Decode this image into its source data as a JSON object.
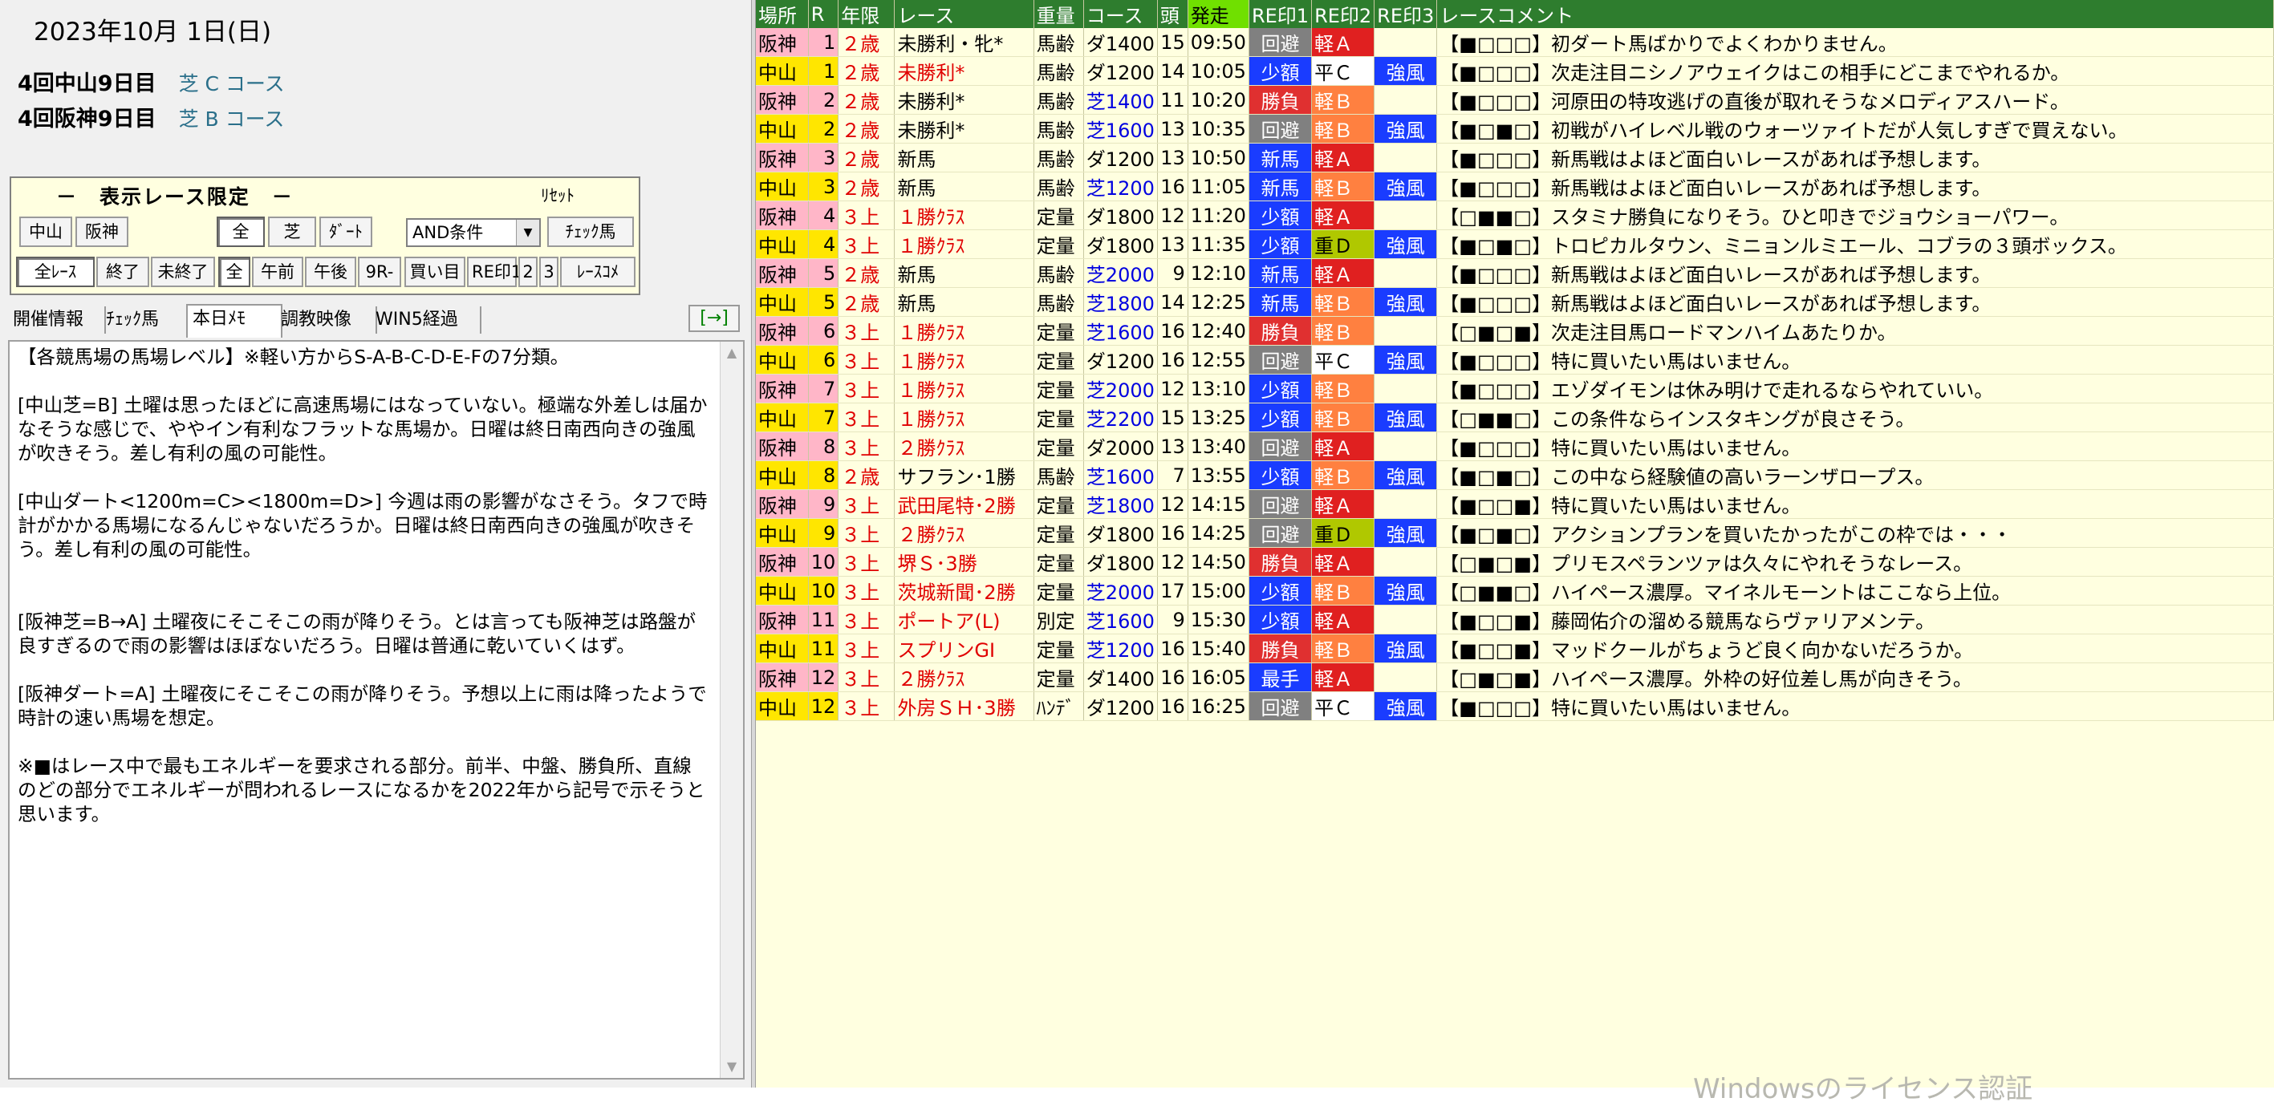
{
  "left": {
    "date": "2023年10月 1日(日)",
    "meetings": [
      {
        "name": "4回中山9日目",
        "course": "芝 C コース"
      },
      {
        "name": "4回阪神9日目",
        "course": "芝 B コース"
      }
    ],
    "filter": {
      "title": "－　表示レース限定　－",
      "reset": "ﾘｾｯﾄ",
      "buttons_row1": [
        "中山",
        "阪神",
        "全",
        "芝",
        "ﾀﾞｰﾄ",
        "ﾁｪｯｸ馬"
      ],
      "select_value": "AND条件",
      "buttons_row2": [
        "全ﾚｰｽ",
        "終了",
        "未終了",
        "全",
        "午前",
        "午後",
        "9R-",
        "買い目",
        "RE印1",
        "2",
        "3",
        "ﾚｰｽｺﾒ"
      ]
    },
    "tabs": [
      "開催情報",
      "ﾁｪｯｸ馬",
      "本日ﾒﾓ",
      "調教映像",
      "WIN5経過"
    ],
    "arrow_button": "[→]",
    "memo": "【各競馬場の馬場レベル】※軽い方からS-A-B-C-D-E-Fの7分類。\n\n[中山芝=B] 土曜は思ったほどに高速馬場にはなっていない。極端な外差しは届かなそうな感じで、ややイン有利なフラットな馬場か。日曜は終日南西向きの強風が吹きそう。差し有利の風の可能性。\n\n[中山ダート<1200m=C><1800m=D>] 今週は雨の影響がなさそう。タフで時計がかかる馬場になるんじゃないだろうか。日曜は終日南西向きの強風が吹きそう。差し有利の風の可能性。\n\n\n[阪神芝=B→A] 土曜夜にそこそこの雨が降りそう。とは言っても阪神芝は路盤が良すぎるので雨の影響はほぼないだろう。日曜は普通に乾いていくはず。\n\n[阪神ダート=A] 土曜夜にそこそこの雨が降りそう。予想以上に雨は降ったようで時計の速い馬場を想定。\n\n※■はレース中で最もエネルギーを要求される部分。前半、中盤、勝負所、直線のどの部分でエネルギーが問われるレースになるかを2022年から記号で示そうと思います。"
  },
  "table": {
    "headers": [
      "場所",
      "R",
      "年限",
      "レース",
      "重量",
      "コース",
      "頭",
      "発走",
      "RE印1",
      "RE印2",
      "RE印3",
      "レースコメント"
    ],
    "rows": [
      {
        "place": "阪神",
        "r": "1",
        "age": "２歳",
        "race": "未勝利・牝*",
        "race_red": false,
        "weight": "馬齢",
        "course": "ダ1400",
        "course_turf": false,
        "heads": "15",
        "time": "09:50",
        "m1": "回避",
        "m1c": "kaihi",
        "m2": "軽Ａ",
        "m2c": "keiA",
        "m3": "",
        "comment": "【■□□□】初ダート馬ばかりでよくわかりません。"
      },
      {
        "place": "中山",
        "r": "1",
        "age": "２歳",
        "race": "未勝利*",
        "race_red": true,
        "weight": "馬齢",
        "course": "ダ1200",
        "course_turf": false,
        "heads": "14",
        "time": "10:05",
        "m1": "少額",
        "m1c": "shogaku",
        "m2": "平Ｃ",
        "m2c": "heiC",
        "m3": "強風",
        "comment": "【■□□□】次走注目ニシノアウェイクはこの相手にどこまでやれるか。"
      },
      {
        "place": "阪神",
        "r": "2",
        "age": "２歳",
        "race": "未勝利*",
        "race_red": false,
        "weight": "馬齢",
        "course": "芝1400",
        "course_turf": true,
        "heads": "11",
        "time": "10:20",
        "m1": "勝負",
        "m1c": "shoubu",
        "m2": "軽Ｂ",
        "m2c": "keiB",
        "m3": "",
        "comment": "【■□□□】河原田の特攻逃げの直後が取れそうなメロディアスハード。"
      },
      {
        "place": "中山",
        "r": "2",
        "age": "２歳",
        "race": "未勝利*",
        "race_red": false,
        "weight": "馬齢",
        "course": "芝1600",
        "course_turf": true,
        "heads": "13",
        "time": "10:35",
        "m1": "回避",
        "m1c": "kaihi",
        "m2": "軽Ｂ",
        "m2c": "keiB",
        "m3": "強風",
        "comment": "【■□■□】初戦がハイレベル戦のウォーツァイトだが人気しすぎで買えない。"
      },
      {
        "place": "阪神",
        "r": "3",
        "age": "２歳",
        "race": "新馬",
        "race_red": false,
        "weight": "馬齢",
        "course": "ダ1200",
        "course_turf": false,
        "heads": "13",
        "time": "10:50",
        "m1": "新馬",
        "m1c": "shinba",
        "m2": "軽Ａ",
        "m2c": "keiA",
        "m3": "",
        "comment": "【■□□□】新馬戦はよほど面白いレースがあれば予想します。"
      },
      {
        "place": "中山",
        "r": "3",
        "age": "２歳",
        "race": "新馬",
        "race_red": false,
        "weight": "馬齢",
        "course": "芝1200",
        "course_turf": true,
        "heads": "16",
        "time": "11:05",
        "m1": "新馬",
        "m1c": "shinba",
        "m2": "軽Ｂ",
        "m2c": "keiB",
        "m3": "強風",
        "comment": "【■□□□】新馬戦はよほど面白いレースがあれば予想します。"
      },
      {
        "place": "阪神",
        "r": "4",
        "age": "３上",
        "race": "１勝ｸﾗｽ",
        "race_red": true,
        "weight": "定量",
        "course": "ダ1800",
        "course_turf": false,
        "heads": "12",
        "time": "11:20",
        "m1": "少額",
        "m1c": "shogaku",
        "m2": "軽Ａ",
        "m2c": "keiA",
        "m3": "",
        "comment": "【□■■□】スタミナ勝負になりそう。ひと叩きでジョウショーパワー。"
      },
      {
        "place": "中山",
        "r": "4",
        "age": "３上",
        "race": "１勝ｸﾗｽ",
        "race_red": true,
        "weight": "定量",
        "course": "ダ1800",
        "course_turf": false,
        "heads": "13",
        "time": "11:35",
        "m1": "少額",
        "m1c": "shogaku",
        "m2": "重Ｄ",
        "m2c": "juuD",
        "m3": "強風",
        "comment": "【■□■□】トロピカルタウン、ミニョンルミエール、コブラの３頭ボックス。"
      },
      {
        "place": "阪神",
        "r": "5",
        "age": "２歳",
        "race": "新馬",
        "race_red": false,
        "weight": "馬齢",
        "course": "芝2000",
        "course_turf": true,
        "heads": "9",
        "time": "12:10",
        "m1": "新馬",
        "m1c": "shinba",
        "m2": "軽Ａ",
        "m2c": "keiA",
        "m3": "",
        "comment": "【■□□□】新馬戦はよほど面白いレースがあれば予想します。"
      },
      {
        "place": "中山",
        "r": "5",
        "age": "２歳",
        "race": "新馬",
        "race_red": false,
        "weight": "馬齢",
        "course": "芝1800",
        "course_turf": true,
        "heads": "14",
        "time": "12:25",
        "m1": "新馬",
        "m1c": "shinba",
        "m2": "軽Ｂ",
        "m2c": "keiB",
        "m3": "強風",
        "comment": "【■□□□】新馬戦はよほど面白いレースがあれば予想します。"
      },
      {
        "place": "阪神",
        "r": "6",
        "age": "３上",
        "race": "１勝ｸﾗｽ",
        "race_red": true,
        "weight": "定量",
        "course": "芝1600",
        "course_turf": true,
        "heads": "16",
        "time": "12:40",
        "m1": "勝負",
        "m1c": "shoubu",
        "m2": "軽Ｂ",
        "m2c": "keiB",
        "m3": "",
        "comment": "【□■□■】次走注目馬ロードマンハイムあたりか。"
      },
      {
        "place": "中山",
        "r": "6",
        "age": "３上",
        "race": "１勝ｸﾗｽ",
        "race_red": true,
        "weight": "定量",
        "course": "ダ1200",
        "course_turf": false,
        "heads": "16",
        "time": "12:55",
        "m1": "回避",
        "m1c": "kaihi",
        "m2": "平Ｃ",
        "m2c": "heiC",
        "m3": "強風",
        "comment": "【■□□□】特に買いたい馬はいません。"
      },
      {
        "place": "阪神",
        "r": "7",
        "age": "３上",
        "race": "１勝ｸﾗｽ",
        "race_red": true,
        "weight": "定量",
        "course": "芝2000",
        "course_turf": true,
        "heads": "12",
        "time": "13:10",
        "m1": "少額",
        "m1c": "shogaku",
        "m2": "軽Ｂ",
        "m2c": "keiB",
        "m3": "",
        "comment": "【■□□□】エゾダイモンは休み明けで走れるならやれていい。"
      },
      {
        "place": "中山",
        "r": "7",
        "age": "３上",
        "race": "１勝ｸﾗｽ",
        "race_red": true,
        "weight": "定量",
        "course": "芝2200",
        "course_turf": true,
        "heads": "15",
        "time": "13:25",
        "m1": "少額",
        "m1c": "shogaku",
        "m2": "軽Ｂ",
        "m2c": "keiB",
        "m3": "強風",
        "comment": "【□■■□】この条件ならインスタキングが良さそう。"
      },
      {
        "place": "阪神",
        "r": "8",
        "age": "３上",
        "race": "２勝ｸﾗｽ",
        "race_red": true,
        "weight": "定量",
        "course": "ダ2000",
        "course_turf": false,
        "heads": "13",
        "time": "13:40",
        "m1": "回避",
        "m1c": "kaihi",
        "m2": "軽Ａ",
        "m2c": "keiA",
        "m3": "",
        "comment": "【■□□□】特に買いたい馬はいません。"
      },
      {
        "place": "中山",
        "r": "8",
        "age": "２歳",
        "race": "サフラン･1勝",
        "race_red": false,
        "weight": "馬齢",
        "course": "芝1600",
        "course_turf": true,
        "heads": "7",
        "time": "13:55",
        "m1": "少額",
        "m1c": "shogaku",
        "m2": "軽Ｂ",
        "m2c": "keiB",
        "m3": "強風",
        "comment": "【■□■□】この中なら経験値の高いラーンザロープス。"
      },
      {
        "place": "阪神",
        "r": "9",
        "age": "３上",
        "race": "武田尾特･2勝",
        "race_red": true,
        "weight": "定量",
        "course": "芝1800",
        "course_turf": true,
        "heads": "12",
        "time": "14:15",
        "m1": "回避",
        "m1c": "kaihi",
        "m2": "軽Ａ",
        "m2c": "keiA",
        "m3": "",
        "comment": "【■□□■】特に買いたい馬はいません。"
      },
      {
        "place": "中山",
        "r": "9",
        "age": "３上",
        "race": "２勝ｸﾗｽ",
        "race_red": true,
        "weight": "定量",
        "course": "ダ1800",
        "course_turf": false,
        "heads": "16",
        "time": "14:25",
        "m1": "回避",
        "m1c": "kaihi",
        "m2": "重Ｄ",
        "m2c": "juuD",
        "m3": "強風",
        "comment": "【■□■□】アクションプランを買いたかったがこの枠では・・・"
      },
      {
        "place": "阪神",
        "r": "10",
        "age": "３上",
        "race": "堺Ｓ･3勝",
        "race_red": true,
        "weight": "定量",
        "course": "ダ1800",
        "course_turf": false,
        "heads": "12",
        "time": "14:50",
        "m1": "勝負",
        "m1c": "shoubu",
        "m2": "軽Ａ",
        "m2c": "keiA",
        "m3": "",
        "comment": "【□■□■】プリモスペランツァは久々にやれそうなレース。"
      },
      {
        "place": "中山",
        "r": "10",
        "age": "３上",
        "race": "茨城新聞･2勝",
        "race_red": true,
        "weight": "定量",
        "course": "芝2000",
        "course_turf": true,
        "heads": "17",
        "time": "15:00",
        "m1": "少額",
        "m1c": "shogaku",
        "m2": "軽Ｂ",
        "m2c": "keiB",
        "m3": "強風",
        "comment": "【□■■□】ハイペース濃厚。マイネルモーントはここなら上位。"
      },
      {
        "place": "阪神",
        "r": "11",
        "age": "３上",
        "race": "ポートア(L)",
        "race_red": true,
        "weight": "別定",
        "course": "芝1600",
        "course_turf": true,
        "heads": "9",
        "time": "15:30",
        "m1": "少額",
        "m1c": "shogaku",
        "m2": "軽Ａ",
        "m2c": "keiA",
        "m3": "",
        "comment": "【■□□■】藤岡佑介の溜める競馬ならヴァリアメンテ。"
      },
      {
        "place": "中山",
        "r": "11",
        "age": "３上",
        "race": "スプリンGⅠ",
        "race_red": true,
        "weight": "定量",
        "course": "芝1200",
        "course_turf": true,
        "heads": "16",
        "time": "15:40",
        "m1": "勝負",
        "m1c": "shoubu",
        "m2": "軽Ｂ",
        "m2c": "keiB",
        "m3": "強風",
        "comment": "【■□□■】マッドクールがちょうど良く向かないだろうか。"
      },
      {
        "place": "阪神",
        "r": "12",
        "age": "３上",
        "race": "２勝ｸﾗｽ",
        "race_red": true,
        "weight": "定量",
        "course": "ダ1400",
        "course_turf": false,
        "heads": "16",
        "time": "16:05",
        "m1": "最手",
        "m1c": "saishu",
        "m2": "軽Ａ",
        "m2c": "keiA",
        "m3": "",
        "comment": "【□■□■】ハイペース濃厚。外枠の好位差し馬が向きそう。"
      },
      {
        "place": "中山",
        "r": "12",
        "age": "３上",
        "race": "外房ＳＨ･3勝",
        "race_red": true,
        "weight": "ﾊﾝﾃﾞ",
        "course": "ダ1200",
        "course_turf": false,
        "heads": "16",
        "time": "16:25",
        "m1": "回避",
        "m1c": "kaihi",
        "m2": "平Ｃ",
        "m2c": "heiC",
        "m3": "強風",
        "comment": "【■□□□】特に買いたい馬はいません。"
      }
    ]
  },
  "watermark": "Windowsのライセンス認証"
}
